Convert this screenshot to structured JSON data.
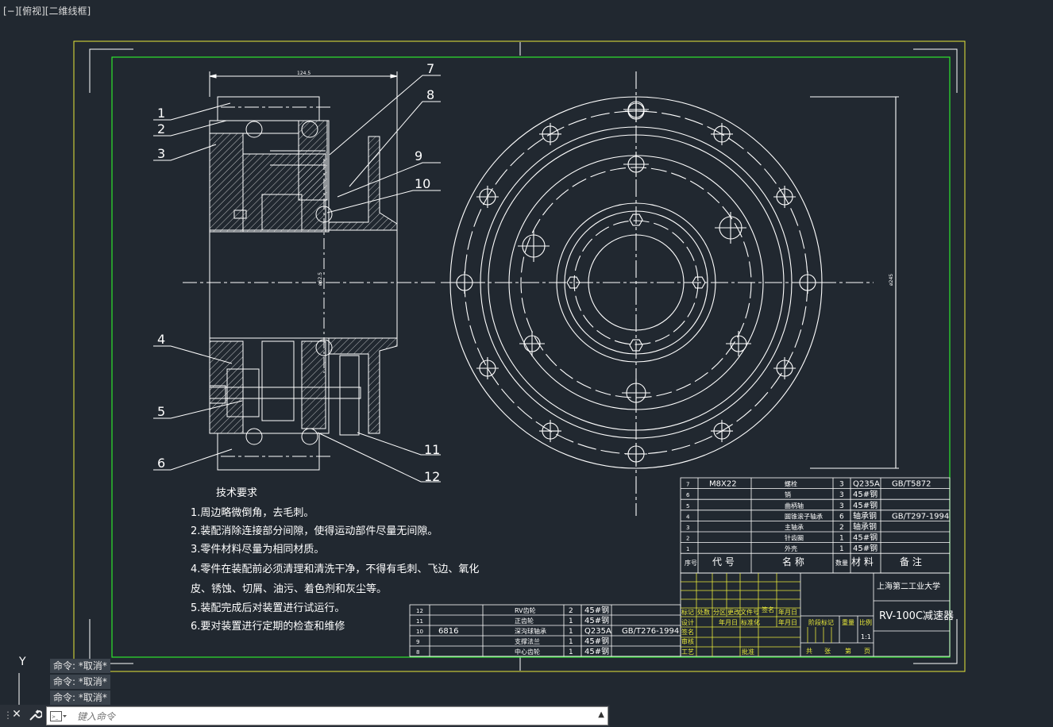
{
  "viewport": {
    "label": "[−][俯视][二维线框]"
  },
  "ucs": {
    "y_label": "Y"
  },
  "command_history": [
    "命令: *取消*",
    "命令: *取消*",
    "命令: *取消*"
  ],
  "command_line": {
    "placeholder": "键入命令"
  },
  "colors": {
    "background": "#212830",
    "border_yellow": "#e8e83a",
    "frame_green": "#2ee62e",
    "line_white": "#ffffff",
    "table_yellow": "#e8e83a"
  },
  "drawing": {
    "dim_width": "124.5",
    "dim_bore": "ø62.5",
    "dim_outer": "ø245",
    "part_labels": [
      "1",
      "2",
      "3",
      "4",
      "5",
      "6",
      "7",
      "8",
      "9",
      "10",
      "11",
      "12"
    ]
  },
  "tech_requirements": {
    "title": "技术要求",
    "items": [
      "1.周边略微倒角，去毛刺。",
      "2.装配消除连接部分间隙，使得运动部件尽量无间隙。",
      "3.零件材料尽量为相同材质。",
      "4.零件在装配前必须清理和清洗干净，不得有毛刺、飞边、氧化",
      "皮、锈蚀、切屑、油污、着色剂和灰尘等。",
      "5.装配完成后对装置进行试运行。",
      "6.要对装置进行定期的检查和维修"
    ]
  },
  "bom_upper": {
    "rows": [
      {
        "no": "7",
        "code": "M8X22",
        "name": "螺栓",
        "qty": "3",
        "material": "Q235A",
        "note": "GB/T5872"
      },
      {
        "no": "6",
        "code": "",
        "name": "销",
        "qty": "3",
        "material": "45#钢",
        "note": ""
      },
      {
        "no": "5",
        "code": "",
        "name": "曲柄轴",
        "qty": "3",
        "material": "45#钢",
        "note": ""
      },
      {
        "no": "4",
        "code": "",
        "name": "圆锥滚子轴承",
        "qty": "6",
        "material": "轴承钢",
        "note": "GB/T297-1994"
      },
      {
        "no": "3",
        "code": "",
        "name": "主轴承",
        "qty": "2",
        "material": "轴承钢",
        "note": ""
      },
      {
        "no": "2",
        "code": "",
        "name": "针齿圈",
        "qty": "1",
        "material": "45#钢",
        "note": ""
      },
      {
        "no": "1",
        "code": "",
        "name": "外壳",
        "qty": "1",
        "material": "45#钢",
        "note": ""
      }
    ],
    "header": {
      "no": "序号",
      "code": "代 号",
      "name": "名 称",
      "qty": "数量",
      "material": "材 料",
      "note": "备 注"
    }
  },
  "bom_lower": {
    "rows": [
      {
        "no": "12",
        "code": "",
        "name": "RV齿轮",
        "qty": "2",
        "material": "45#钢",
        "note": ""
      },
      {
        "no": "11",
        "code": "",
        "name": "正齿轮",
        "qty": "1",
        "material": "45#钢",
        "note": ""
      },
      {
        "no": "10",
        "code": "6816",
        "name": "深沟球轴承",
        "qty": "1",
        "material": "Q235A",
        "note": "GB/T276-1994"
      },
      {
        "no": "9",
        "code": "",
        "name": "支撑法兰",
        "qty": "1",
        "material": "45#钢",
        "note": ""
      },
      {
        "no": "8",
        "code": "",
        "name": "中心齿轮",
        "qty": "1",
        "material": "45#钢",
        "note": ""
      }
    ]
  },
  "title_block": {
    "university": "上海第二工业大学",
    "drawing_name": "RV-100C减速器",
    "row_labels": [
      "标记",
      "处数",
      "分区",
      "更改文件号",
      "签名",
      "年月日"
    ],
    "design": "设计",
    "standard": "标准化",
    "date": "年月日",
    "check": "审核",
    "process": "工艺",
    "approve": "批准",
    "stage": "阶段标记",
    "weight": "重量",
    "scale": "比例",
    "scale_value": "1:1",
    "total": "共",
    "sheet": "张",
    "page": "第",
    "page_unit": "页",
    "signature": "签名"
  }
}
